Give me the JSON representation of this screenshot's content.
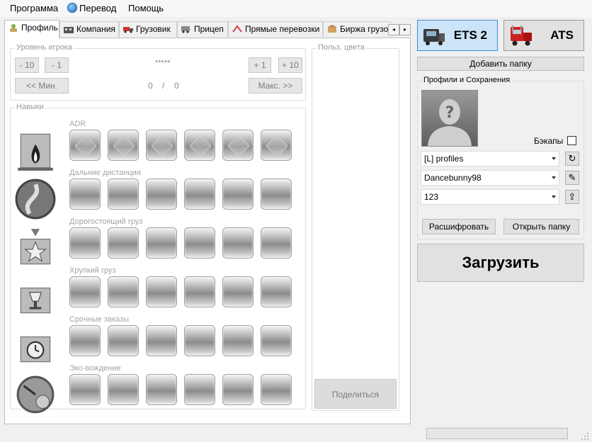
{
  "menu": {
    "items": [
      "Программа",
      "Перевод",
      "Помощь"
    ]
  },
  "tabs": [
    "Профиль",
    "Компания",
    "Грузовик",
    "Прицеп",
    "Прямые перевозки",
    "Биржа грузо"
  ],
  "tab_scroll": {
    "left": "◂",
    "right": "▸"
  },
  "level": {
    "legend": "Уровень игрока",
    "stars": "*****",
    "minus10": "- 10",
    "minus1": "- 1",
    "plus1": "+ 1",
    "plus10": "+ 10",
    "min": "<< Мин.",
    "max": "Макс. >>",
    "xp_current": "0",
    "xp_sep": "/",
    "xp_total": "0"
  },
  "skills": {
    "legend": "Навыки",
    "rows": [
      {
        "label": "ADR",
        "icon": "adr-icon"
      },
      {
        "label": "Дальние дистанции",
        "icon": "long-distance-icon"
      },
      {
        "label": "Дорогостоящий груз",
        "icon": "high-value-cargo-icon"
      },
      {
        "label": "Хрупкий груз",
        "icon": "fragile-cargo-icon"
      },
      {
        "label": "Срочные заказы",
        "icon": "urgent-delivery-icon"
      },
      {
        "label": "Эко-вождение",
        "icon": "eco-driving-icon"
      }
    ]
  },
  "colors": {
    "legend": "Польз. цвета",
    "share": "Поделиться"
  },
  "games": [
    {
      "label": "ETS 2",
      "active": true,
      "icon": "ets2-truck-icon"
    },
    {
      "label": "ATS",
      "active": false,
      "icon": "ats-truck-icon"
    }
  ],
  "add_folder": "Добавить папку",
  "profiles": {
    "legend": "Профили и Сохранения",
    "avatar_glyph": "?",
    "backups_label": "Бэкапы",
    "folder": "[L] profiles",
    "profile": "Dancebunny98",
    "save": "123",
    "decrypt": "Расшифровать",
    "open_folder": "Открыть папку"
  },
  "load": "Загрузить",
  "accent": "#cce4f7"
}
